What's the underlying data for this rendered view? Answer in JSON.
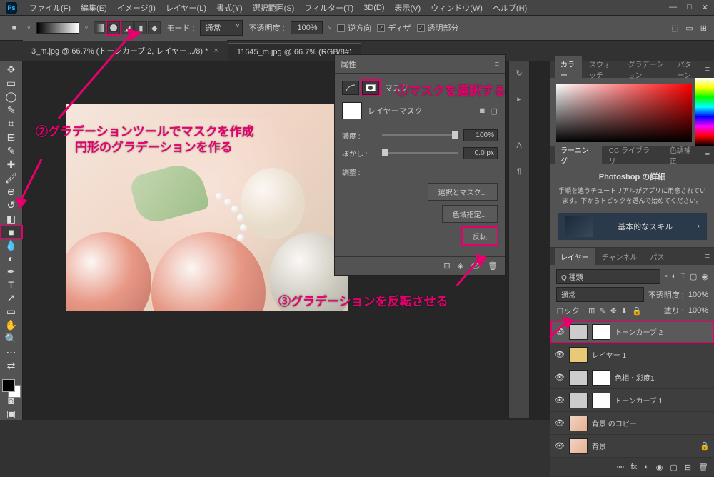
{
  "menu": {
    "items": [
      "ファイル(F)",
      "編集(E)",
      "イメージ(I)",
      "レイヤー(L)",
      "書式(Y)",
      "選択範囲(S)",
      "フィルター(T)",
      "3D(D)",
      "表示(V)",
      "ウィンドウ(W)",
      "ヘルプ(H)"
    ],
    "logo": "Ps"
  },
  "optbar": {
    "mode_label": "モード :",
    "mode_value": "通常",
    "opacity_label": "不透明度 :",
    "opacity_value": "100%",
    "reverse": "逆方向",
    "dither": "ディザ",
    "transparent": "透明部分"
  },
  "tabs": {
    "t1": "3_m.jpg @ 66.7% (トーンカーブ 2, レイヤー.../8) *",
    "t2": "11645_m.jpg @ 66.7% (RGB/8#)"
  },
  "prop": {
    "title": "属性",
    "mask_label": "マスク",
    "layer_mask": "レイヤーマスク",
    "density_label": "濃度 :",
    "density_value": "100%",
    "feather_label": "ぼかし :",
    "feather_value": "0.0 px",
    "adjust_label": "調整 :",
    "select_mask_btn": "選択とマスク...",
    "color_range_btn": "色域指定...",
    "invert_btn": "反転"
  },
  "color_tabs": {
    "t1": "カラー",
    "t2": "スウォッチ",
    "t3": "グラデーション",
    "t4": "パターン"
  },
  "adjust_tabs": {
    "t1": "ラーニング",
    "t2": "CC ライブラリ",
    "t3": "色調補正"
  },
  "learn": {
    "title": "Photoshop の詳細",
    "desc": "手順を追うチュートリアルがアプリに用意されています。下からトピックを選んで始めてください。",
    "card": "基本的なスキル"
  },
  "layer_tabs": {
    "t1": "レイヤー",
    "t2": "チャンネル",
    "t3": "パス"
  },
  "layer_opts": {
    "kind": "Q 種類",
    "blend": "通常",
    "opacity_label": "不透明度 :",
    "opacity": "100%",
    "lock_label": "ロック :",
    "fill_label": "塗り :",
    "fill": "100%"
  },
  "layers": {
    "l1": "トーンカーブ 2",
    "l2": "レイヤー 1",
    "l3": "色相・彩度1",
    "l4": "トーンカーブ 1",
    "l5": "背景 のコピー",
    "l6": "背景"
  },
  "annot": {
    "a1": "①マスクを選択する",
    "a2": "②グラデーションツールでマスクを作成",
    "a2b": "円形のグラデーションを作る",
    "a3": "③グラデーションを反転させる"
  }
}
